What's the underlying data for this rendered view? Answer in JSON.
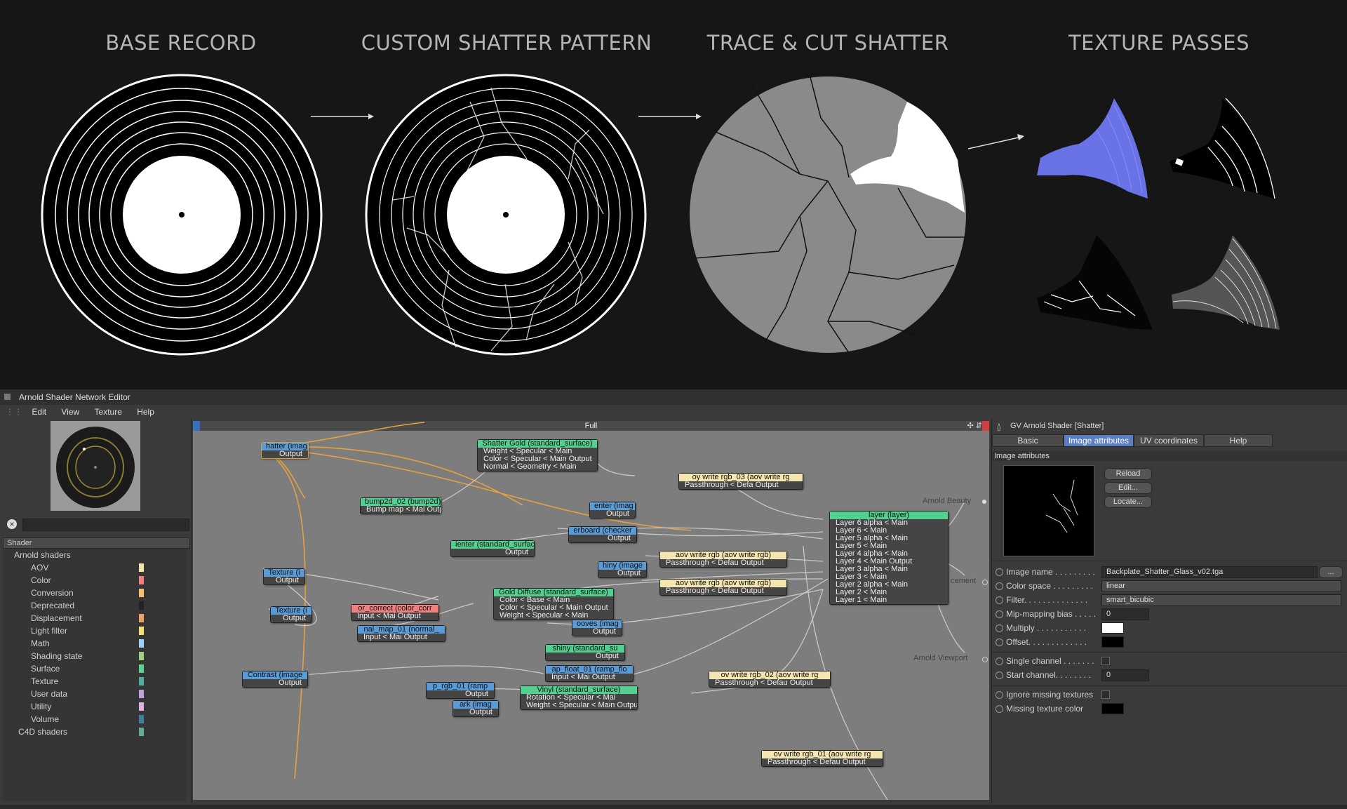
{
  "stages": [
    {
      "title": "BASE RECORD"
    },
    {
      "title": "CUSTOM SHATTER PATTERN"
    },
    {
      "title": "TRACE & CUT SHATTER"
    },
    {
      "title": "TEXTURE PASSES"
    }
  ],
  "editor": {
    "window_title": "Arnold Shader Network Editor",
    "menu": [
      "Edit",
      "View",
      "Texture",
      "Help"
    ],
    "canvas_title": "Full",
    "search_placeholder": "",
    "tree_header": "Shader",
    "tree": [
      {
        "label": "Arnold shaders",
        "color": ""
      },
      {
        "label": "AOV",
        "color": "#f0e6a8"
      },
      {
        "label": "Color",
        "color": "#f08080"
      },
      {
        "label": "Conversion",
        "color": "#f0c070"
      },
      {
        "label": "Deprecated",
        "color": "#222222"
      },
      {
        "label": "Displacement",
        "color": "#f0a060"
      },
      {
        "label": "Light filter",
        "color": "#f0e070"
      },
      {
        "label": "Math",
        "color": "#a0d0f0"
      },
      {
        "label": "Shading state",
        "color": "#a0d080"
      },
      {
        "label": "Surface",
        "color": "#60d090"
      },
      {
        "label": "Texture",
        "color": "#50b0a0"
      },
      {
        "label": "User data",
        "color": "#c0a0e0"
      },
      {
        "label": "Utility",
        "color": "#e0b0e0"
      },
      {
        "label": "Volume",
        "color": "#4080a0"
      },
      {
        "label": "C4D shaders",
        "color": "#60b090"
      }
    ],
    "nodes": [
      {
        "title": "hatter (imag",
        "rows": [
          "Output"
        ],
        "color": "#5b9bd5"
      },
      {
        "title": "Shatter Gold (standard_surface)",
        "rows": [
          "Weight < Specular < Main",
          "Color < Specular < Main   Output",
          "Normal < Geometry < Main"
        ],
        "color": "#53d08f"
      },
      {
        "title": "bump2d_02 (bump2d)",
        "rows": [
          "Bump map < Mai Output"
        ],
        "color": "#53d08f"
      },
      {
        "title": "oy write rgb_03 (aov write rg",
        "rows": [
          "Passthrough < Defa Output"
        ],
        "color": "#f4e6b0"
      },
      {
        "title": "enter (imag",
        "rows": [
          "Output"
        ],
        "color": "#5b9bd5"
      },
      {
        "title": "erboard (checker",
        "rows": [
          "Output"
        ],
        "color": "#5b9bd5"
      },
      {
        "title": "ienter (standard_surfac",
        "rows": [
          "Output"
        ],
        "color": "#53d08f"
      },
      {
        "title": "aov write rgb (aov write rgb)",
        "rows": [
          "Passthrough < Defau Output"
        ],
        "color": "#f4e6b0"
      },
      {
        "title": "hiny (image",
        "rows": [
          "Output"
        ],
        "color": "#5b9bd5"
      },
      {
        "title": "aov write rgb (aov write rgb)",
        "rows": [
          "Passthrough < Defau Output"
        ],
        "color": "#f4e6b0"
      },
      {
        "title": "layer (layer)",
        "rows": [
          "Layer 6 alpha < Main",
          "Layer 6 < Main",
          "Layer 5 alpha < Main",
          "Layer 5 < Main",
          "Layer 4 alpha < Main",
          "Layer 4 < Main         Output",
          "Layer 3 alpha < Main",
          "Layer 3 < Main",
          "Layer 2 alpha < Main",
          "Layer 2 < Main",
          "Layer 1 < Main"
        ],
        "color": "#53d08f"
      },
      {
        "title": "Texture (i",
        "rows": [
          "Output"
        ],
        "color": "#5b9bd5"
      },
      {
        "title": "Gold Diffuse (standard_surface)",
        "rows": [
          "Color < Base < Main",
          "Color < Specular < Main  Output",
          "Weight < Specular < Main"
        ],
        "color": "#53d08f"
      },
      {
        "title": "Texture (i",
        "rows": [
          "Output"
        ],
        "color": "#5b9bd5"
      },
      {
        "title": "or_correct (color_corr",
        "rows": [
          "Input < Mai Output"
        ],
        "color": "#f08080"
      },
      {
        "title": "nal_map_01 (normal_",
        "rows": [
          "Input < Mai Output"
        ],
        "color": "#5b9bd5"
      },
      {
        "title": "ooves (imag",
        "rows": [
          "Output"
        ],
        "color": "#5b9bd5"
      },
      {
        "title": "shiny (standard_su",
        "rows": [
          "Output"
        ],
        "color": "#53d08f"
      },
      {
        "title": "ap_float_01 (ramp_flo",
        "rows": [
          "Input < Mai Output"
        ],
        "color": "#5b9bd5"
      },
      {
        "title": "Contrast (image",
        "rows": [
          "Output"
        ],
        "color": "#5b9bd5"
      },
      {
        "title": "p_rgb_01 (ramp",
        "rows": [
          "Output"
        ],
        "color": "#5b9bd5"
      },
      {
        "title": "Vinyl (standard_surface)",
        "rows": [
          "Rotation < Specular < Mai",
          "Weight < Specular < Main Output"
        ],
        "color": "#53d08f"
      },
      {
        "title": "ov write rgb_02 (aov write rg",
        "rows": [
          "Passthrough < Defau Output"
        ],
        "color": "#f4e6b0"
      },
      {
        "title": "ark (imag",
        "rows": [
          "Output"
        ],
        "color": "#5b9bd5"
      },
      {
        "title": "ov write rgb_01 (aov write rg",
        "rows": [
          "Passthrough < Defau Output"
        ],
        "color": "#f4e6b0"
      }
    ],
    "outputs": [
      "Arnold Beauty",
      "cement",
      "Arnold Viewport"
    ],
    "attr_panel": {
      "title": "GV Arnold Shader [Shatter]",
      "tabs": [
        "Basic",
        "Image attributes",
        "UV coordinates",
        "Help"
      ],
      "section": "Image attributes",
      "buttons": [
        "Reload",
        "Edit...",
        "Locate..."
      ],
      "props": [
        {
          "label": "Image name . . . . . . . . .",
          "value": "Backplate_Shatter_Glass_v02.tga"
        },
        {
          "label": "Color space . . . . . . . . .",
          "value": "linear"
        },
        {
          "label": "Filter. . . . . . . . . . . . . .",
          "value": "smart_bicubic"
        },
        {
          "label": "Mip-mapping bias . . . . .",
          "value": "0"
        },
        {
          "label": "Multiply . . . . . . . . . . .",
          "value": ""
        },
        {
          "label": "Offset. . . . . . . . . . . . .",
          "value": ""
        },
        {
          "label": "Single channel . . . . . . .",
          "value": ""
        },
        {
          "label": "Start channel. . . . . . . .",
          "value": "0"
        },
        {
          "label": "Ignore missing textures",
          "value": ""
        },
        {
          "label": "Missing texture color",
          "value": ""
        }
      ],
      "more_button": "..."
    }
  }
}
